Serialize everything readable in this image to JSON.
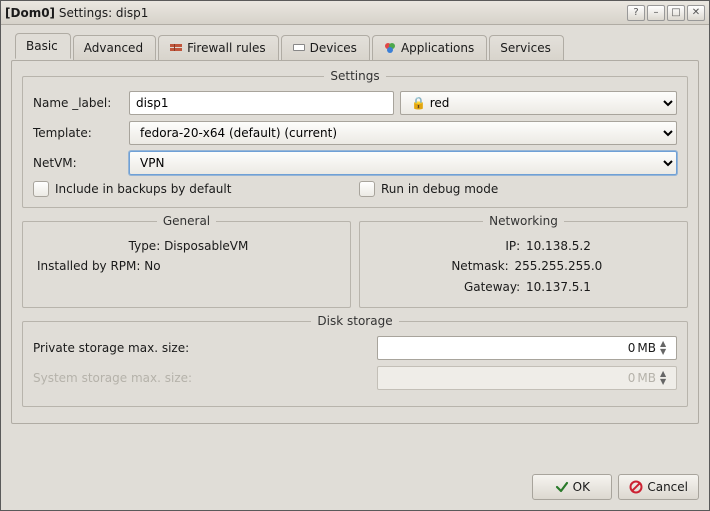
{
  "window": {
    "title_prefix": "[Dom0]",
    "title_rest": " Settings: disp1"
  },
  "tabs": {
    "basic": "Basic",
    "advanced": "Advanced",
    "firewall": "Firewall rules",
    "devices": "Devices",
    "applications": "Applications",
    "services": "Services"
  },
  "settings_group": {
    "legend": "Settings",
    "name_label": "Name _label:",
    "name_value": "disp1",
    "color_label": "red",
    "template_label": "Template:",
    "template_value": "fedora-20-x64 (default) (current)",
    "netvm_label": "NetVM:",
    "netvm_value": "VPN",
    "include_backups": "Include in backups by default",
    "debug_mode": "Run in debug mode"
  },
  "general": {
    "legend": "General",
    "type_label": "Type:",
    "type_value": "DisposableVM",
    "rpm_label": "Installed by RPM:",
    "rpm_value": "No"
  },
  "networking": {
    "legend": "Networking",
    "ip_label": "IP:",
    "ip_value": "10.138.5.2",
    "netmask_label": "Netmask:",
    "netmask_value": "255.255.255.0",
    "gateway_label": "Gateway:",
    "gateway_value": "10.137.5.1"
  },
  "disk": {
    "legend": "Disk storage",
    "private_label": "Private storage max. size:",
    "private_value": "0",
    "private_unit": "MB",
    "system_label": "System storage max. size:",
    "system_value": "0",
    "system_unit": "MB"
  },
  "buttons": {
    "ok": "OK",
    "cancel": "Cancel"
  }
}
